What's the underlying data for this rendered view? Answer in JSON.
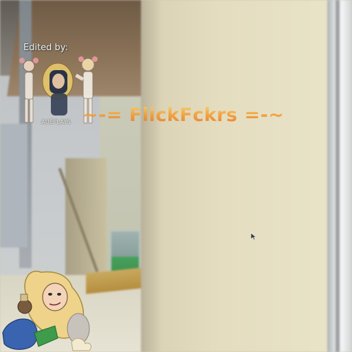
{
  "watermark": {
    "edited_by": "Edited by:",
    "title": "~-= FlickFckrs =-~",
    "logo_caption": "AUEPLAYS"
  },
  "scene": {
    "type": "first-person-3d-game-view",
    "colors": {
      "wall": "#e4ddc0",
      "ceiling_beam": "#8b7358",
      "floor": "#e7e3d4",
      "ledge": "#c9a95e",
      "vending_accent": "#46a05a",
      "title_gradient_top": "#ffd26a",
      "title_gradient_bottom": "#e86a1a"
    }
  },
  "icons": {
    "cursor": "mouse-cursor-icon",
    "logo": "avatar-group-logo-icon",
    "mascot": "cartoon-mascot-icon"
  }
}
